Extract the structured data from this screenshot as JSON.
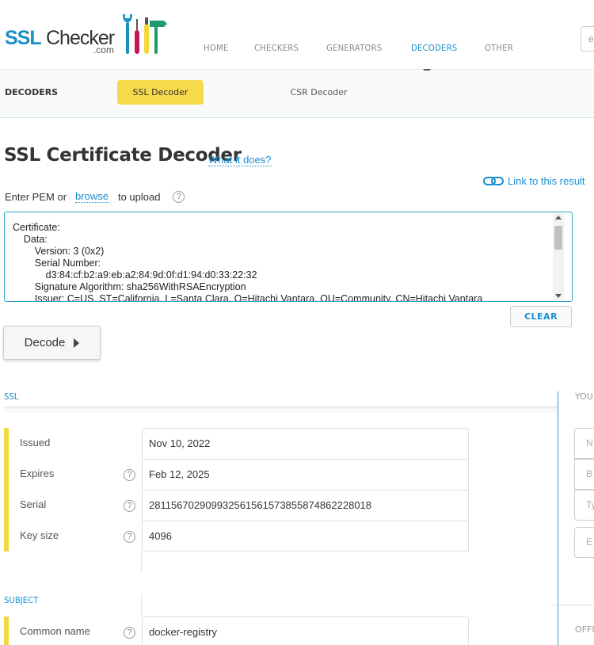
{
  "header": {
    "logo": {
      "ssl": "SSL",
      "checker": "Checker",
      "dotcom": ".com"
    },
    "nav": [
      {
        "label": "HOME",
        "active": false
      },
      {
        "label": "CHECKERS",
        "active": false
      },
      {
        "label": "GENERATORS",
        "active": false
      },
      {
        "label": "DECODERS",
        "active": true
      },
      {
        "label": "OTHER",
        "active": false
      }
    ],
    "search_placeholder": "e"
  },
  "subnav": {
    "label": "DECODERS",
    "tabs": [
      {
        "label": "SSL Decoder",
        "active": true
      },
      {
        "label": "CSR Decoder",
        "active": false
      }
    ]
  },
  "main": {
    "title": "SSL Certificate Decoder",
    "what_link": "What it does?",
    "link_result": "Link to this result",
    "pem_prefix": "Enter PEM or",
    "browse": "browse",
    "pem_suffix": "to upload",
    "help_mark": "?",
    "pem_text": "Certificate:\n    Data:\n        Version: 3 (0x2)\n        Serial Number:\n            d3:84:cf:b2:a9:eb:a2:84:9d:0f:d1:94:d0:33:22:32\n        Signature Algorithm: sha256WithRSAEncryption\n        Issuer: C=US, ST=California, L=Santa Clara, O=Hitachi Vantara, OU=Community, CN=Hitachi Vantara",
    "clear_label": "CLEAR",
    "decode_label": "Decode"
  },
  "ssl_section": {
    "label": "SSL",
    "rows": [
      {
        "label": "Issued",
        "value": "Nov 10, 2022",
        "help": false
      },
      {
        "label": "Expires",
        "value": "Feb 12, 2025",
        "help": true
      },
      {
        "label": "Serial",
        "value": "281156702909932561561573855874862228018",
        "help": true
      },
      {
        "label": "Key size",
        "value": "4096",
        "help": true
      }
    ]
  },
  "subject_section": {
    "label": "SUBJECT",
    "rows": [
      {
        "label": "Common name",
        "value": "docker-registry",
        "help": true
      }
    ]
  },
  "right_panel": {
    "label": "YOU",
    "fields": [
      "N",
      "B",
      "Ty",
      "E"
    ],
    "label2": "OFFI"
  },
  "colors": {
    "accent": "#1a8fd0",
    "highlight": "#f7d94c",
    "border_focus": "#2aa5c7"
  }
}
